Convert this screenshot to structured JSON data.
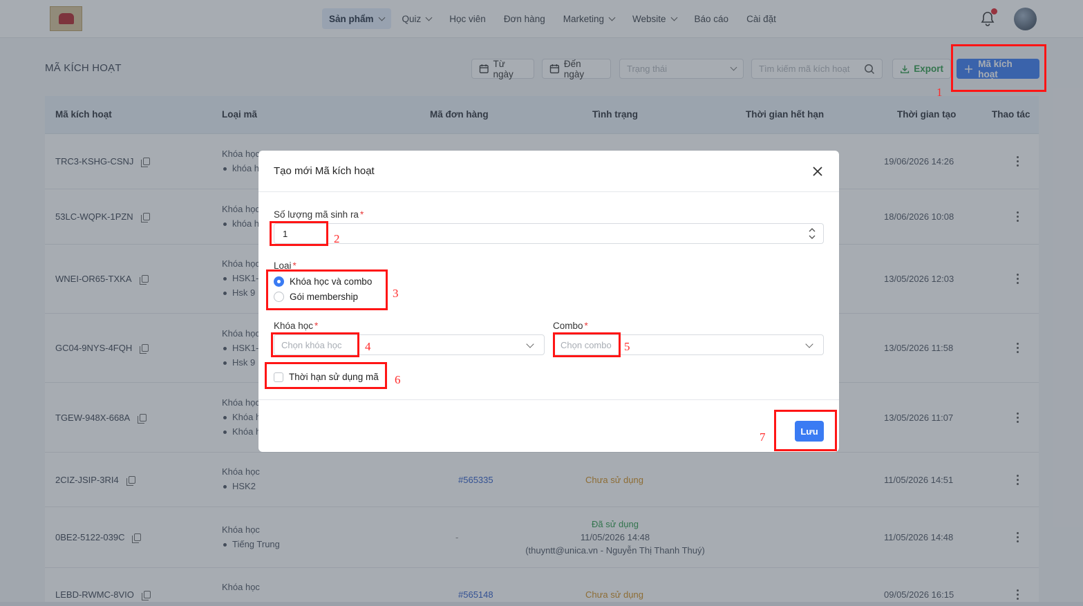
{
  "nav": {
    "items": [
      {
        "label": "Sản phẩm",
        "dropdown": true,
        "active": true
      },
      {
        "label": "Quiz",
        "dropdown": true
      },
      {
        "label": "Học viên"
      },
      {
        "label": "Đơn hàng"
      },
      {
        "label": "Marketing",
        "dropdown": true
      },
      {
        "label": "Website",
        "dropdown": true
      },
      {
        "label": "Báo cáo"
      },
      {
        "label": "Cài đặt"
      }
    ],
    "notification_icon": "bell-icon",
    "has_unread": true
  },
  "page": {
    "title": "MÃ KÍCH HOẠT",
    "filters": {
      "from_date": "Từ ngày",
      "to_date": "Đến ngày",
      "status_placeholder": "Trạng thái",
      "search_placeholder": "Tìm kiếm mã kích hoạt"
    },
    "export_label": "Export",
    "add_label": "Mã kích hoạt"
  },
  "table": {
    "columns": [
      "Mã kích hoạt",
      "Loại mã",
      "Mã đơn hàng",
      "Tình trạng",
      "Thời gian hết hạn",
      "Thời gian tạo",
      "Thao tác"
    ],
    "rows": [
      {
        "code": "TRC3-KSHG-CSNJ",
        "type": "Khóa học",
        "items": [
          "khóa h"
        ],
        "created": "19/06/2026 14:26"
      },
      {
        "code": "53LC-WQPK-1PZN",
        "type": "Khóa học",
        "items": [
          "khóa h"
        ],
        "created": "18/06/2026 10:08"
      },
      {
        "code": "WNEI-OR65-TXKA",
        "type": "Khóa học",
        "items": [
          "HSK1-",
          "Hsk 9"
        ],
        "created": "13/05/2026 12:03"
      },
      {
        "code": "GC04-9NYS-4FQH",
        "type": "Khóa học",
        "items": [
          "HSK1-",
          "Hsk 9"
        ],
        "created": "13/05/2026 11:58"
      },
      {
        "code": "TGEW-948X-668A",
        "type": "Khóa học",
        "items": [
          "Khóa h",
          "Khóa h"
        ],
        "created": "13/05/2026 11:07"
      },
      {
        "code": "2CIZ-JSIP-3RI4",
        "type": "Khóa học",
        "items": [
          "HSK2"
        ],
        "order": "#565335",
        "status": "Chưa sử dụng",
        "created": "11/05/2026 14:51"
      },
      {
        "code": "0BE2-5122-039C",
        "type": "Khóa học",
        "items": [
          "Tiếng Trung"
        ],
        "order": "-",
        "status": "Đã sử dụng",
        "used_at": "11/05/2026 14:48",
        "used_by": "(thuyntt@unica.vn - Nguyễn Thị Thanh Thuý)",
        "created": "11/05/2026 14:48"
      },
      {
        "code": "LEBD-RWMC-8VIO",
        "type": "Khóa học",
        "items": [],
        "order": "#565148",
        "status": "Chưa sử dụng",
        "created": "09/05/2026 16:15"
      }
    ]
  },
  "modal": {
    "title": "Tạo mới Mã kích hoạt",
    "quantity_label": "Số lượng mã sinh ra",
    "quantity_value": "1",
    "type_label": "Loại",
    "type_options": [
      "Khóa học và combo",
      "Gói membership"
    ],
    "type_selected": "Khóa học và combo",
    "course_label": "Khóa học",
    "course_placeholder": "Chọn khóa học",
    "combo_label": "Combo",
    "combo_placeholder": "Chọn combo",
    "expiry_checkbox_label": "Thời hạn sử dụng mã",
    "expiry_checked": false,
    "save_label": "Lưu"
  },
  "annotations": [
    "1",
    "2",
    "3",
    "4",
    "5",
    "6",
    "7"
  ],
  "colors": {
    "primary": "#3a7bf3",
    "annotation": "#ff1515",
    "unused_status": "#d08c1c",
    "used_status": "#2c9a49",
    "order_link": "#2d5ac7"
  }
}
